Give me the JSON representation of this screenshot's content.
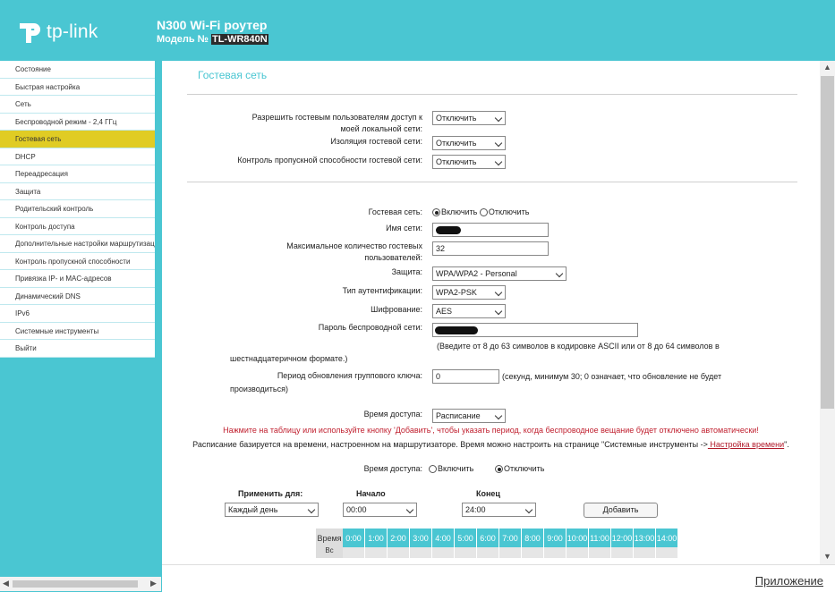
{
  "header": {
    "logo_text": "tp-link",
    "product": "N300 Wi-Fi роутер",
    "model_prefix": "Модель №",
    "model": "TL-WR840N",
    "brand_color": "#4ac6d2"
  },
  "sidebar": {
    "items": [
      {
        "label": "Состояние"
      },
      {
        "label": "Быстрая настройка"
      },
      {
        "label": "Сеть"
      },
      {
        "label": "Беспроводной режим - 2,4 ГГц"
      },
      {
        "label": "Гостевая сеть",
        "active": true
      },
      {
        "label": "DHCP"
      },
      {
        "label": "Переадресация"
      },
      {
        "label": "Защита"
      },
      {
        "label": "Родительский контроль"
      },
      {
        "label": "Контроль доступа"
      },
      {
        "label": "Дополнительные настройки маршрутизации"
      },
      {
        "label": "Контроль пропускной способности"
      },
      {
        "label": "Привязка IP- и MAC-адресов"
      },
      {
        "label": "Динамический DNS"
      },
      {
        "label": "IPv6"
      },
      {
        "label": "Системные инструменты"
      },
      {
        "label": "Выйти"
      }
    ]
  },
  "main": {
    "title": "Гостевая сеть",
    "local_access_label_1": "Разрешить гостевым пользователям доступ к",
    "local_access_label_2": "моей локальной сети:",
    "local_access_value": "Отключить",
    "isolation_label": "Изоляция гостевой сети:",
    "isolation_value": "Отключить",
    "bandwidth_label": "Контроль пропускной способности гостевой сети:",
    "bandwidth_value": "Отключить",
    "guest_net_label": "Гостевая сеть:",
    "enable_label": "Включить",
    "disable_label": "Отключить",
    "ssid_label": "Имя сети:",
    "max_users_label_1": "Максимальное количество гостевых",
    "max_users_label_2": "пользователей:",
    "max_users_value": "32",
    "security_label": "Защита:",
    "security_value": "WPA/WPA2 - Personal",
    "auth_label": "Тип аутентификации:",
    "auth_value": "WPA2-PSK",
    "encryption_label": "Шифрование:",
    "encryption_value": "AES",
    "password_label": "Пароль беспроводной сети:",
    "password_hint_1": "(Введите от 8 до 63 символов в кодировке ASCII или от 8 до 64 символов в",
    "password_hint_2": "шестнадцатеричном формате.)",
    "group_key_label": "Период обновления группового ключа:",
    "group_key_value": "0",
    "group_key_hint_1": "(секунд, минимум 30; 0 означает, что обновление не будет",
    "group_key_hint_2": "производиться)",
    "access_time_label": "Время доступа:",
    "access_time_value": "Расписание",
    "schedule_note_red": "Нажмите на таблицу или используйте кнопку 'Добавить', чтобы указать период, когда беспроводное вещание будет отключено автоматически!",
    "schedule_note": "Расписание базируется на времени, настроенном на маршрутизаторе. Время можно настроить на странице \"Системные инструменты ->",
    "schedule_link": " Настройка времени",
    "schedule_note_end": "\".",
    "access_time2_label": "Время доступа:",
    "access_enable": "Включить",
    "access_disable": "Отключить",
    "apply_label": "Применить для:",
    "apply_value": "Каждый день",
    "start_label": "Начало",
    "start_value": "00:00",
    "end_label": "Конец",
    "end_value": "24:00",
    "add_button": "Добавить",
    "table_time_label": "Время",
    "table_day_label": "Вс",
    "hours": [
      "0:00",
      "1:00",
      "2:00",
      "3:00",
      "4:00",
      "5:00",
      "6:00",
      "7:00",
      "8:00",
      "9:00",
      "10:00",
      "11:00",
      "12:00",
      "13:00",
      "14:00"
    ]
  },
  "footer": {
    "appendix": "Приложение"
  }
}
